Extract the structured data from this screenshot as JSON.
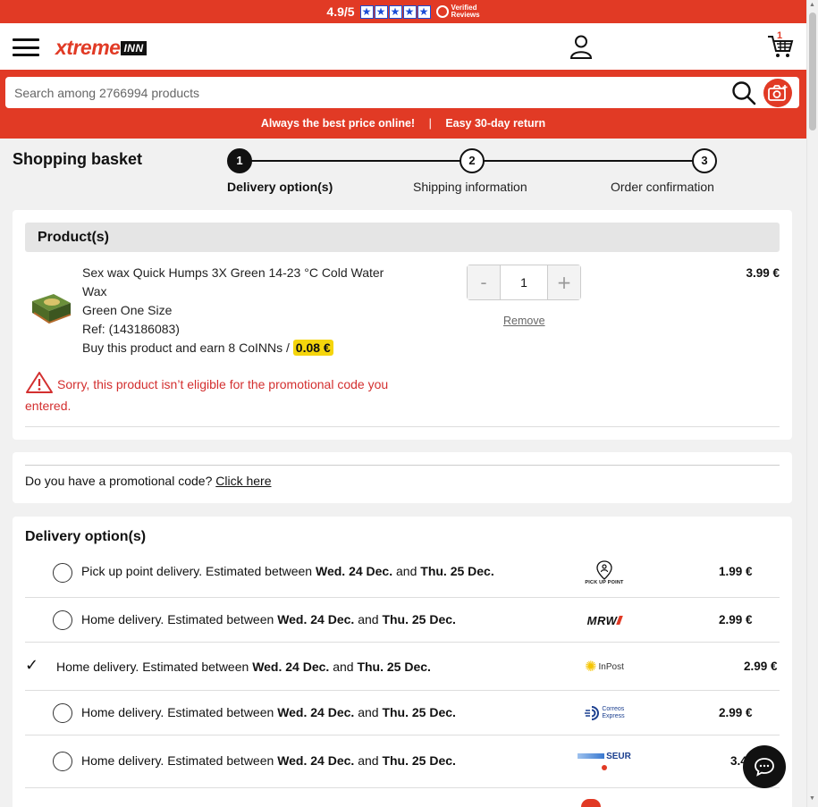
{
  "rating_bar": {
    "score": "4.9/5",
    "verified_line1": "Verified",
    "verified_line2": "Reviews",
    "star_glyph": "★",
    "color": "#e13a25"
  },
  "header": {
    "logo_main": "xtreme",
    "logo_suffix": "INN",
    "cart_count": "1",
    "icons": [
      "menu-icon",
      "user-icon",
      "cart-icon"
    ]
  },
  "search": {
    "placeholder": "Search among 2766994 products",
    "icons": [
      "search-icon",
      "camera-icon"
    ]
  },
  "promo_strip": {
    "left": "Always the best price online!",
    "separator": "|",
    "right": "Easy 30-day return"
  },
  "basket": {
    "title": "Shopping basket"
  },
  "steps": [
    {
      "number": "1",
      "label": "Delivery option(s)",
      "active": true
    },
    {
      "number": "2",
      "label": "Shipping information",
      "active": false
    },
    {
      "number": "3",
      "label": "Order confirmation",
      "active": false
    }
  ],
  "products": {
    "header": "Product(s)",
    "item": {
      "name": "Sex wax Quick Humps 3X Green 14-23 °C Cold Water Wax",
      "variant": "Green One Size",
      "ref": "Ref: (143186083)",
      "earn_text": "Buy this product and earn 8 CoINNs /",
      "earn_value": "0.08 €",
      "quantity": "1",
      "minus": "-",
      "plus": "+",
      "remove_label": "Remove",
      "price": "3.99 €",
      "warning": "Sorry, this product isn’t eligible for the promotional code you entered."
    }
  },
  "promo_code": {
    "question": "Do you have a promotional code?",
    "link": "Click here"
  },
  "delivery": {
    "title": "Delivery option(s)",
    "options": [
      {
        "prefix": "Pick up point delivery. Estimated between",
        "date1": "Wed. 24 Dec.",
        "and": "and",
        "date2": "Thu. 25 Dec.",
        "carrier": "PICK UP POINT",
        "price": "1.99 €",
        "selected": false
      },
      {
        "prefix": "Home delivery. Estimated between",
        "date1": "Wed. 24 Dec.",
        "and": "and",
        "date2": "Thu. 25 Dec.",
        "carrier": "MRW",
        "price": "2.99 €",
        "selected": false
      },
      {
        "prefix": "Home delivery. Estimated between",
        "date1": "Wed. 24 Dec.",
        "and": "and",
        "date2": "Thu. 25 Dec.",
        "carrier": "InPost",
        "price": "2.99 €",
        "selected": true
      },
      {
        "prefix": "Home delivery. Estimated between",
        "date1": "Wed. 24 Dec.",
        "and": "and",
        "date2": "Thu. 25 Dec.",
        "carrier_line1": "Correos",
        "carrier_line2": "Express",
        "price": "2.99 €",
        "selected": false
      },
      {
        "prefix": "Home delivery. Estimated between",
        "date1": "Wed. 24 Dec.",
        "and": "and",
        "date2": "Thu. 25 Dec.",
        "carrier": "SEUR",
        "price": "3.49",
        "selected": false
      }
    ]
  },
  "colors": {
    "brand_red": "#e13a25",
    "warning_red": "#d32f2f",
    "coin_yellow": "#f5d50c",
    "star_blue": "#1b4cd6"
  }
}
